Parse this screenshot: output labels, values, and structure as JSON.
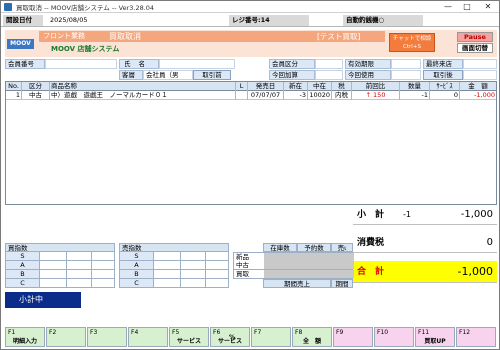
{
  "window": {
    "title": "買取取消 -- MOOV店舗システム -- Ver3.28.04",
    "controls": {
      "minimize": "—",
      "maximize": "□",
      "close": "✕"
    }
  },
  "statusbar": {
    "date_label": "開設日付",
    "date_value": "2025/08/05",
    "register_label": "レジ番号:14",
    "auto_mode_label": "自動釣銭機○"
  },
  "header": {
    "logo": "MOOV",
    "section": "フロント業務",
    "screen_name": "買取取消",
    "mode_badge": "[テスト買取]",
    "store_system": "MOOV 店舗システム",
    "chat_button": {
      "line1": "チャットで相談",
      "line2": "Ctrl+S"
    },
    "pause_button": "Pause",
    "screen_switch_button": "画面切替"
  },
  "member": {
    "member_no_label": "会員番号",
    "name_label": "氏名",
    "member_type_label": "会員区分",
    "expiry_label": "有効期限",
    "last_visit_label": "最終来店",
    "customer_label": "客層",
    "customer_value": "会社員（男",
    "customer_btn": "取引前",
    "add_today_label": "今回加算",
    "use_today_label": "今回使用",
    "after_trade_btn": "取引後"
  },
  "grid": {
    "headers": [
      "No.",
      "区分",
      "商品名称",
      "L",
      "発売日",
      "新在",
      "中在",
      "税",
      "前回比",
      "数量",
      "ｻｰﾋﾞｽ",
      "金　額"
    ],
    "rows": [
      {
        "no": "1",
        "kubun": "中古",
        "name": "中）遊戯　遊戯王　ノーマルカード０１",
        "l": "",
        "release": "07/07/07",
        "new_stock": "-3",
        "used_stock": "10020",
        "tax": "内税",
        "prev": "↑ 150",
        "qty": "-1",
        "service": "0",
        "amount": "-1,000"
      }
    ]
  },
  "totals": {
    "subtotal_label": "小　計",
    "subtotal_count": "-1",
    "subtotal_value": "-1,000",
    "tax_label": "消費税",
    "tax_value": "0",
    "total_label": "合　計",
    "total_value": "-1,000"
  },
  "purchase_panel": {
    "title": "買指数",
    "rows": [
      "S",
      "A",
      "B",
      "C"
    ]
  },
  "sales_panel": {
    "title": "売指数",
    "rows": [
      "S",
      "A",
      "B",
      "C"
    ]
  },
  "stock_panel": {
    "headers": [
      "在庫数",
      "予約数",
      "売ι"
    ],
    "rows": [
      "新品",
      "中古",
      "買取"
    ],
    "period_sales": "期間売上",
    "period_short": "期間"
  },
  "subtotal_indicator": "小計中",
  "fkeys": [
    {
      "key": "F1",
      "label": "明細入力"
    },
    {
      "key": "F2",
      "label": ""
    },
    {
      "key": "F3",
      "label": ""
    },
    {
      "key": "F4",
      "label": ""
    },
    {
      "key": "F5",
      "label": "サービス"
    },
    {
      "key": "F6",
      "label": "サービス",
      "sub": "%"
    },
    {
      "key": "F7",
      "label": ""
    },
    {
      "key": "F8",
      "label": "全　額"
    },
    {
      "key": "F9",
      "label": ""
    },
    {
      "key": "F10",
      "label": ""
    },
    {
      "key": "F11",
      "label": "買取UP"
    },
    {
      "key": "F12",
      "label": ""
    }
  ],
  "colors": {
    "header_band": "#fbe3d6",
    "header_bar": "#f4a77e",
    "store_title": "#1e7a2e",
    "total_highlight": "#ffff00",
    "prev_up": "#e00000",
    "amount_negative": "#e00000",
    "subtotal_indicator_bg": "#0c2c8c"
  }
}
